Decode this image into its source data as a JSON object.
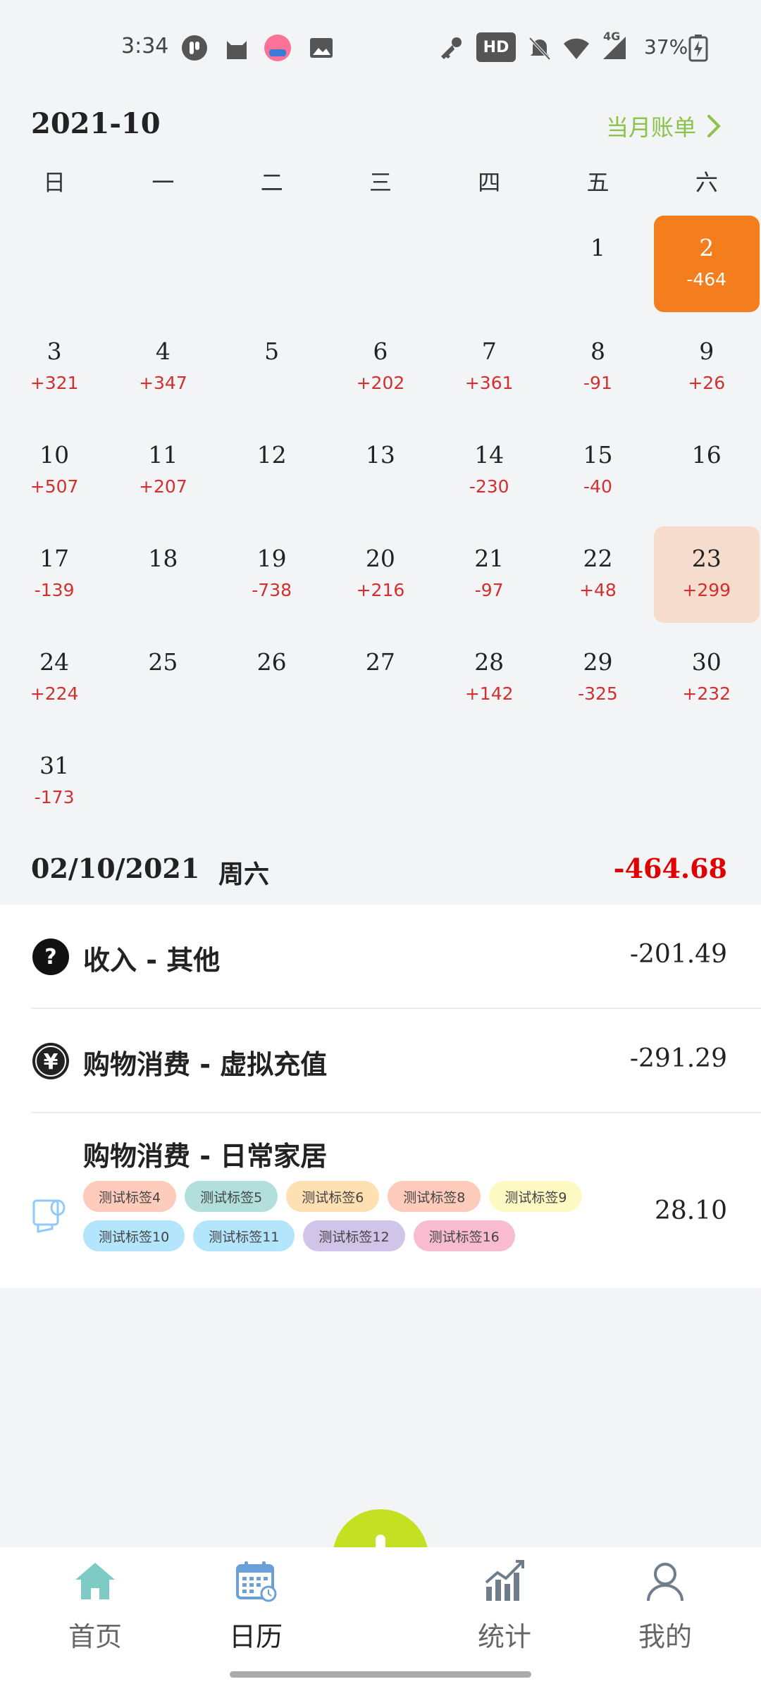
{
  "status_bar": {
    "time": "3:34",
    "battery": "37%",
    "network": "4G",
    "hd": "HD"
  },
  "header": {
    "month": "2021-10",
    "monthly_bill": "当月账单"
  },
  "weekdays": [
    "日",
    "一",
    "二",
    "三",
    "四",
    "五",
    "六"
  ],
  "calendar": {
    "days": [
      {
        "day": "",
        "amount": ""
      },
      {
        "day": "",
        "amount": ""
      },
      {
        "day": "",
        "amount": ""
      },
      {
        "day": "",
        "amount": ""
      },
      {
        "day": "",
        "amount": ""
      },
      {
        "day": "1",
        "amount": ""
      },
      {
        "day": "2",
        "amount": "-464",
        "state": "selected"
      },
      {
        "day": "3",
        "amount": "+321"
      },
      {
        "day": "4",
        "amount": "+347"
      },
      {
        "day": "5",
        "amount": ""
      },
      {
        "day": "6",
        "amount": "+202"
      },
      {
        "day": "7",
        "amount": "+361"
      },
      {
        "day": "8",
        "amount": "-91"
      },
      {
        "day": "9",
        "amount": "+26"
      },
      {
        "day": "10",
        "amount": "+507"
      },
      {
        "day": "11",
        "amount": "+207"
      },
      {
        "day": "12",
        "amount": ""
      },
      {
        "day": "13",
        "amount": ""
      },
      {
        "day": "14",
        "amount": "-230"
      },
      {
        "day": "15",
        "amount": "-40"
      },
      {
        "day": "16",
        "amount": ""
      },
      {
        "day": "17",
        "amount": "-139"
      },
      {
        "day": "18",
        "amount": ""
      },
      {
        "day": "19",
        "amount": "-738"
      },
      {
        "day": "20",
        "amount": "+216"
      },
      {
        "day": "21",
        "amount": "-97"
      },
      {
        "day": "22",
        "amount": "+48"
      },
      {
        "day": "23",
        "amount": "+299",
        "state": "today"
      },
      {
        "day": "24",
        "amount": "+224"
      },
      {
        "day": "25",
        "amount": ""
      },
      {
        "day": "26",
        "amount": ""
      },
      {
        "day": "27",
        "amount": ""
      },
      {
        "day": "28",
        "amount": "+142"
      },
      {
        "day": "29",
        "amount": "-325"
      },
      {
        "day": "30",
        "amount": "+232"
      },
      {
        "day": "31",
        "amount": "-173"
      }
    ]
  },
  "selected": {
    "date": "02/10/2021",
    "weekday": "周六",
    "total": "-464.68"
  },
  "transactions": [
    {
      "title": "收入 - 其他",
      "amount": "-201.49",
      "icon": "question-icon"
    },
    {
      "title": "购物消费 - 虚拟充值",
      "amount": "-291.29",
      "icon": "yen-icon"
    },
    {
      "title": "购物消费 - 日常家居",
      "amount": "28.10",
      "icon": "tissue-roll-icon",
      "tags": [
        {
          "label": "测试标签4",
          "color": "#ffccbc"
        },
        {
          "label": "测试标签5",
          "color": "#b2dfdb"
        },
        {
          "label": "测试标签6",
          "color": "#ffe0b2"
        },
        {
          "label": "测试标签8",
          "color": "#ffccbc"
        },
        {
          "label": "测试标签9",
          "color": "#fff9c4"
        },
        {
          "label": "测试标签10",
          "color": "#b3e5fc"
        },
        {
          "label": "测试标签11",
          "color": "#b3e5fc"
        },
        {
          "label": "测试标签12",
          "color": "#d1c4e9"
        },
        {
          "label": "测试标签16",
          "color": "#f8bbd0"
        }
      ]
    }
  ],
  "nav": {
    "home": "首页",
    "calendar": "日历",
    "stats": "统计",
    "mine": "我的"
  },
  "colors": {
    "accent_green": "#8bc34a",
    "selected_orange": "#f47d1e",
    "today_peach": "#f5dccc",
    "fab_lime": "#c4e022",
    "negative_red": "#d32f2f"
  }
}
